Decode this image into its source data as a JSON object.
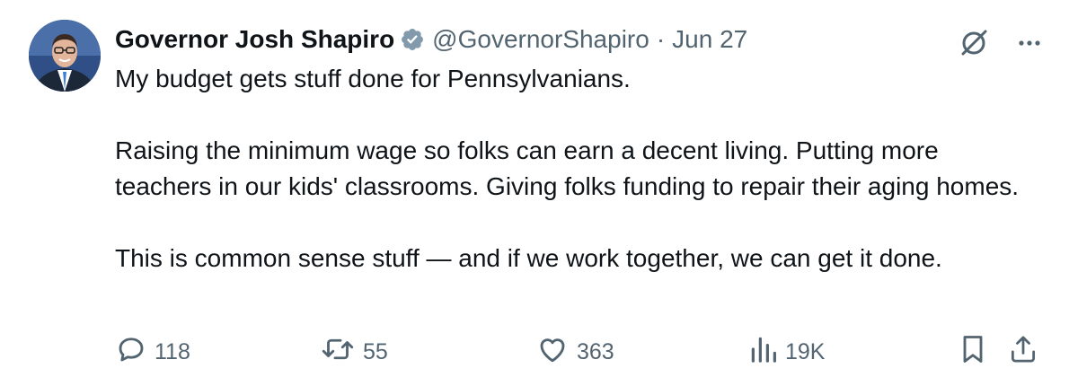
{
  "author": {
    "name": "Governor Josh Shapiro",
    "handle": "@GovernorShapiro",
    "separator": "·",
    "date": "Jun 27"
  },
  "icons": {
    "verified": "verified-badge-icon",
    "grok": "grok-icon",
    "more": "more-icon"
  },
  "tweet": {
    "line1": "My budget gets stuff done for Pennsylvanians.",
    "line2": "Raising the minimum wage so folks can earn a decent living. Putting more teachers in our kids' classrooms. Giving folks funding to repair their aging homes.",
    "line3": "This is common sense stuff — and if we work together, we can get it done."
  },
  "stats": {
    "replies": "118",
    "reposts": "55",
    "likes": "363",
    "views": "19K"
  },
  "colors": {
    "text": "#0f1419",
    "secondary": "#536471",
    "verified": "#829aab"
  }
}
